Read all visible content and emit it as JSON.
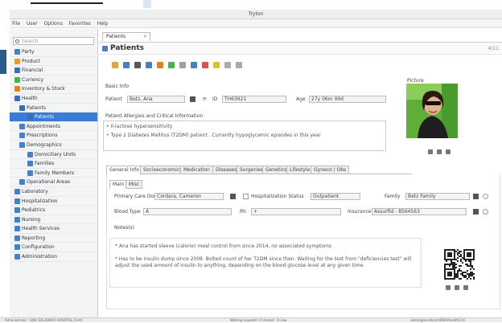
{
  "window": {
    "title": "Tryton"
  },
  "menu": [
    "File",
    "User",
    "Options",
    "Favorites",
    "Help"
  ],
  "search": {
    "placeholder": "Search"
  },
  "sidebar": {
    "items": [
      {
        "label": "Party",
        "level": 0,
        "color": "#4a7fc1"
      },
      {
        "label": "Product",
        "level": 0,
        "color": "#e0a030"
      },
      {
        "label": "Financial",
        "level": 0,
        "color": "#3a6fb0"
      },
      {
        "label": "Currency",
        "level": 0,
        "color": "#4caf50"
      },
      {
        "label": "Inventory & Stock",
        "level": 0,
        "color": "#d9822b"
      },
      {
        "label": "Health",
        "level": 0,
        "color": "#3a6fb0"
      },
      {
        "label": "Patients",
        "level": 1,
        "color": "#3a6fb0"
      },
      {
        "label": "Patients",
        "level": 2,
        "color": "#3a6fb0",
        "selected": true
      },
      {
        "label": "Appointments",
        "level": 1,
        "color": "#4a7fc1"
      },
      {
        "label": "Prescriptions",
        "level": 1,
        "color": "#4a7fc1"
      },
      {
        "label": "Demographics",
        "level": 1,
        "color": "#4a7fc1"
      },
      {
        "label": "Domiciliary Units",
        "level": 2,
        "color": "#4a7fc1"
      },
      {
        "label": "Families",
        "level": 2,
        "color": "#4a7fc1"
      },
      {
        "label": "Family Members",
        "level": 2,
        "color": "#4a7fc1"
      },
      {
        "label": "Operational Areas",
        "level": 1,
        "color": "#4a7fc1"
      },
      {
        "label": "Laboratory",
        "level": 0,
        "color": "#4a7fc1"
      },
      {
        "label": "Hospitalization",
        "level": 0,
        "color": "#4a7fc1"
      },
      {
        "label": "Pediatrics",
        "level": 0,
        "color": "#4a7fc1"
      },
      {
        "label": "Nursing",
        "level": 0,
        "color": "#4a7fc1"
      },
      {
        "label": "Health Services",
        "level": 0,
        "color": "#4a7fc1"
      },
      {
        "label": "Reporting",
        "level": 0,
        "color": "#4a7fc1"
      },
      {
        "label": "Configuration",
        "level": 0,
        "color": "#4a7fc1"
      },
      {
        "label": "Administration",
        "level": 0,
        "color": "#4a7fc1"
      }
    ]
  },
  "tab": {
    "label": "Patients"
  },
  "header": {
    "title": "Patients",
    "counter": "4/11"
  },
  "toolbar_colors": [
    "#e8a43a",
    "#4a7fc1",
    "#555",
    "#4a7fc1",
    "#d9822b",
    "#4caf50",
    "#a0a0a0",
    "#4a7fc1",
    "#e05050",
    "#d9c030",
    "#aaa",
    "#aaa"
  ],
  "form": {
    "section_label": "Basic Info",
    "patient_label": "Patient",
    "patient_value": "Betz, Ana",
    "id_label": "ID",
    "id_value": "TH63921",
    "age_label": "Age",
    "age_value": "27y 06m 09d",
    "allergies_label": "Patient Allergies and Critical Information",
    "notes": [
      "• Il-lactose hypersensitivity",
      "• Type 2 Diabetes Mellitus (T2DM) patient . Currently hypoglycemic episodes in this year"
    ],
    "picture_label": "Picture"
  },
  "tabs": [
    "General Info",
    "Socioeconomics",
    "Medication",
    "Diseases",
    "Surgeries",
    "Genetics",
    "Lifestyle",
    "Gyneco / Obs"
  ],
  "subtabs": [
    "Main",
    "Misc"
  ],
  "general": {
    "pcp_label": "Primary Care Doctor",
    "pcp_value": "Cordara, Cameron",
    "hosp_label": "Hospitalization Status",
    "hosp_value": "Outpatient",
    "family_label": "Family",
    "family_value": "Betz Family",
    "blood_label": "Blood Type",
    "blood_value": "A",
    "rh_label": "Rh",
    "rh_value": "+",
    "insurance_label": "Insurance",
    "insurance_value": "Assurfid - 8564563",
    "notes_label": "Notes(s)",
    "notes": [
      "* Ana has started sleeve (calorie) meal control from since 2014, no associated symptoms",
      "* Has to be insulin dump since 2008. Bolted count of her T2DM since then. Waiting for the test from \"deficiencies test\" will adjust the used amount of insulin to anything, depending on the blood glucose level at any given time."
    ]
  },
  "status": {
    "left": "Administrator - GNU SOLIDARIO HOSPITAL [Fort]",
    "mid": "Waiting requests: 0 Unread - 0 new",
    "right": "admin@localhost:8000/health/2.8"
  }
}
